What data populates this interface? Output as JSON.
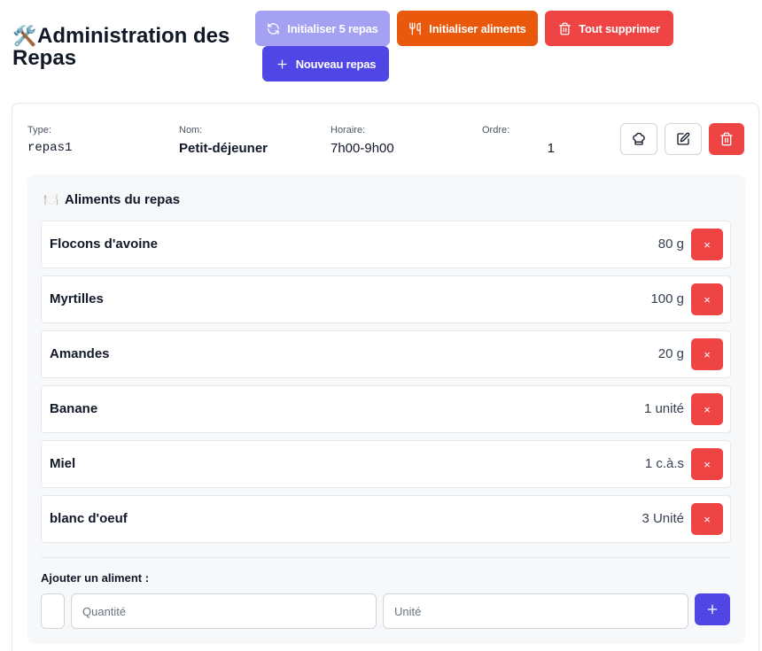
{
  "header": {
    "emoji": "🛠️",
    "title": "Administration des Repas",
    "buttons": {
      "init_repas": "Initialiser 5 repas",
      "init_aliments": "Initialiser aliments",
      "delete_all": "Tout supprimer",
      "new_meal": "Nouveau repas"
    }
  },
  "meal": {
    "type_label": "Type:",
    "type_value": "repas1",
    "name_label": "Nom:",
    "name_value": "Petit-déjeuner",
    "schedule_label": "Horaire:",
    "schedule_value": "7h00-9h00",
    "order_label": "Ordre:",
    "order_value": "1",
    "foods_emoji": "🍽️",
    "foods_title": "Aliments du repas",
    "foods": [
      {
        "name": "Flocons d'avoine",
        "qty": "80 g"
      },
      {
        "name": "Myrtilles",
        "qty": "100 g"
      },
      {
        "name": "Amandes",
        "qty": "20 g"
      },
      {
        "name": "Banane",
        "qty": "1 unité"
      },
      {
        "name": "Miel",
        "qty": "1 c.à.s"
      },
      {
        "name": "blanc d'oeuf",
        "qty": "3 Unité"
      }
    ],
    "remove_glyph": "×",
    "add_label": "Ajouter un aliment :",
    "qty_placeholder": "Quantité",
    "unit_placeholder": "Unité"
  },
  "icons": [
    "refresh-icon",
    "utensils-icon",
    "trash-icon",
    "plus-icon",
    "chef-hat-icon",
    "edit-icon"
  ],
  "colors": {
    "primary": "#4f46e5",
    "primary_disabled": "#a5a1f2",
    "orange": "#ea580c",
    "danger": "#ef4444"
  }
}
